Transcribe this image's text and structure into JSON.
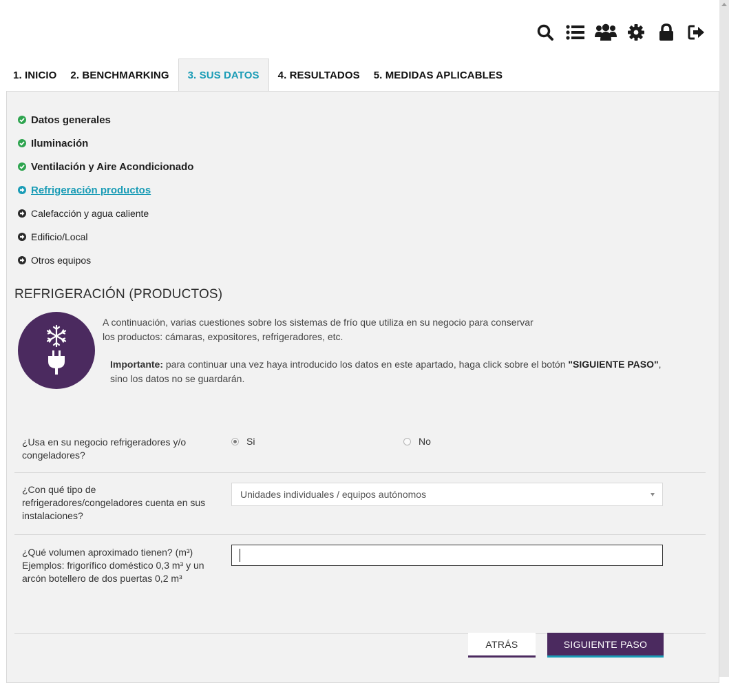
{
  "toolbar": {
    "icons": [
      "search-icon",
      "list-icon",
      "users-icon",
      "gear-icon",
      "lock-icon",
      "logout-icon"
    ]
  },
  "tabs": [
    {
      "label": "1. INICIO",
      "active": false
    },
    {
      "label": "2. BENCHMARKING",
      "active": false
    },
    {
      "label": "3. SUS DATOS",
      "active": true
    },
    {
      "label": "4. RESULTADOS",
      "active": false
    },
    {
      "label": "5. MEDIDAS APLICABLES",
      "active": false
    }
  ],
  "steps": [
    {
      "label": "Datos generales",
      "status": "done"
    },
    {
      "label": "Iluminación",
      "status": "done"
    },
    {
      "label": "Ventilación y Aire Acondicionado",
      "status": "done"
    },
    {
      "label": "Refrigeración productos",
      "status": "current"
    },
    {
      "label": "Calefacción y agua caliente",
      "status": "pending"
    },
    {
      "label": "Edificio/Local",
      "status": "pending"
    },
    {
      "label": "Otros equipos",
      "status": "pending"
    }
  ],
  "section": {
    "title": "REFRIGERACIÓN (PRODUCTOS)",
    "icon": "snowflake-plug-icon",
    "intro_line1": "A continuación, varias cuestiones sobre los sistemas de frío que utiliza en su negocio para conservar",
    "intro_line2": "los productos: cámaras, expositores, refrigeradores, etc.",
    "note_lead": "Importante:",
    "note_text": " para continuar una vez haya introducido los datos en este apartado, haga click sobre el botón ",
    "note_strong": "\"SIGUIENTE PASO\"",
    "note_tail": ", sino los datos no se guardarán."
  },
  "form": {
    "q1": {
      "question": "¿Usa en su negocio refrigeradores y/o congeladores?",
      "options": [
        {
          "label": "Si",
          "checked": true
        },
        {
          "label": "No",
          "checked": false
        }
      ]
    },
    "q2": {
      "question": "¿Con qué tipo de refrigeradores/congeladores cuenta en sus instalaciones?",
      "selected": "Unidades individuales / equipos autónomos"
    },
    "q3": {
      "question": "¿Qué volumen aproximado tienen? (m³) Ejemplos: frigorífico doméstico 0,3 m³ y un arcón botellero de dos puertas 0,2 m³",
      "value": ""
    }
  },
  "buttons": {
    "back": "ATRÁS",
    "next": "SIGUIENTE PASO"
  },
  "colors": {
    "accent": "#1a9cb6",
    "brand": "#4b2a5f",
    "done": "#2ea44f",
    "panel": "#f2f2f2"
  }
}
